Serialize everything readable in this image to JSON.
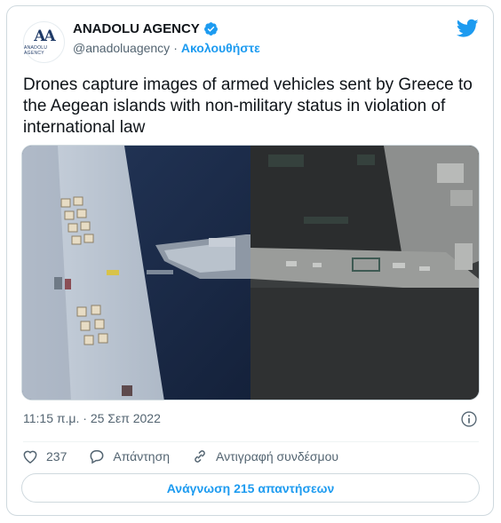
{
  "account": {
    "name": "ANADOLU AGENCY",
    "handle": "@anadoluagency",
    "separator": "·",
    "follow_label": "Ακολουθήστε",
    "avatar_text": "AA",
    "avatar_sub": "ANADOLU AGENCY"
  },
  "tweet": {
    "text": "Drones capture images of armed vehicles sent by Greece to the Aegean islands with non-military status in violation of international law",
    "timestamp": "11:15 π.μ. · 25 Σεπ 2022"
  },
  "actions": {
    "like_count": "237",
    "reply_label": "Απάντηση",
    "copy_link_label": "Αντιγραφή συνδέσμου"
  },
  "read_replies_label": "Ανάγνωση 215 απαντήσεων",
  "colors": {
    "accent": "#1d9bf0",
    "text_primary": "#0f1419",
    "text_secondary": "#536471",
    "border": "#cfd9de"
  },
  "icons": {
    "verified": "verified-badge-icon",
    "platform": "twitter-bird-icon",
    "info": "info-icon",
    "like": "heart-icon",
    "reply": "reply-bubble-icon",
    "copy_link": "link-icon"
  }
}
